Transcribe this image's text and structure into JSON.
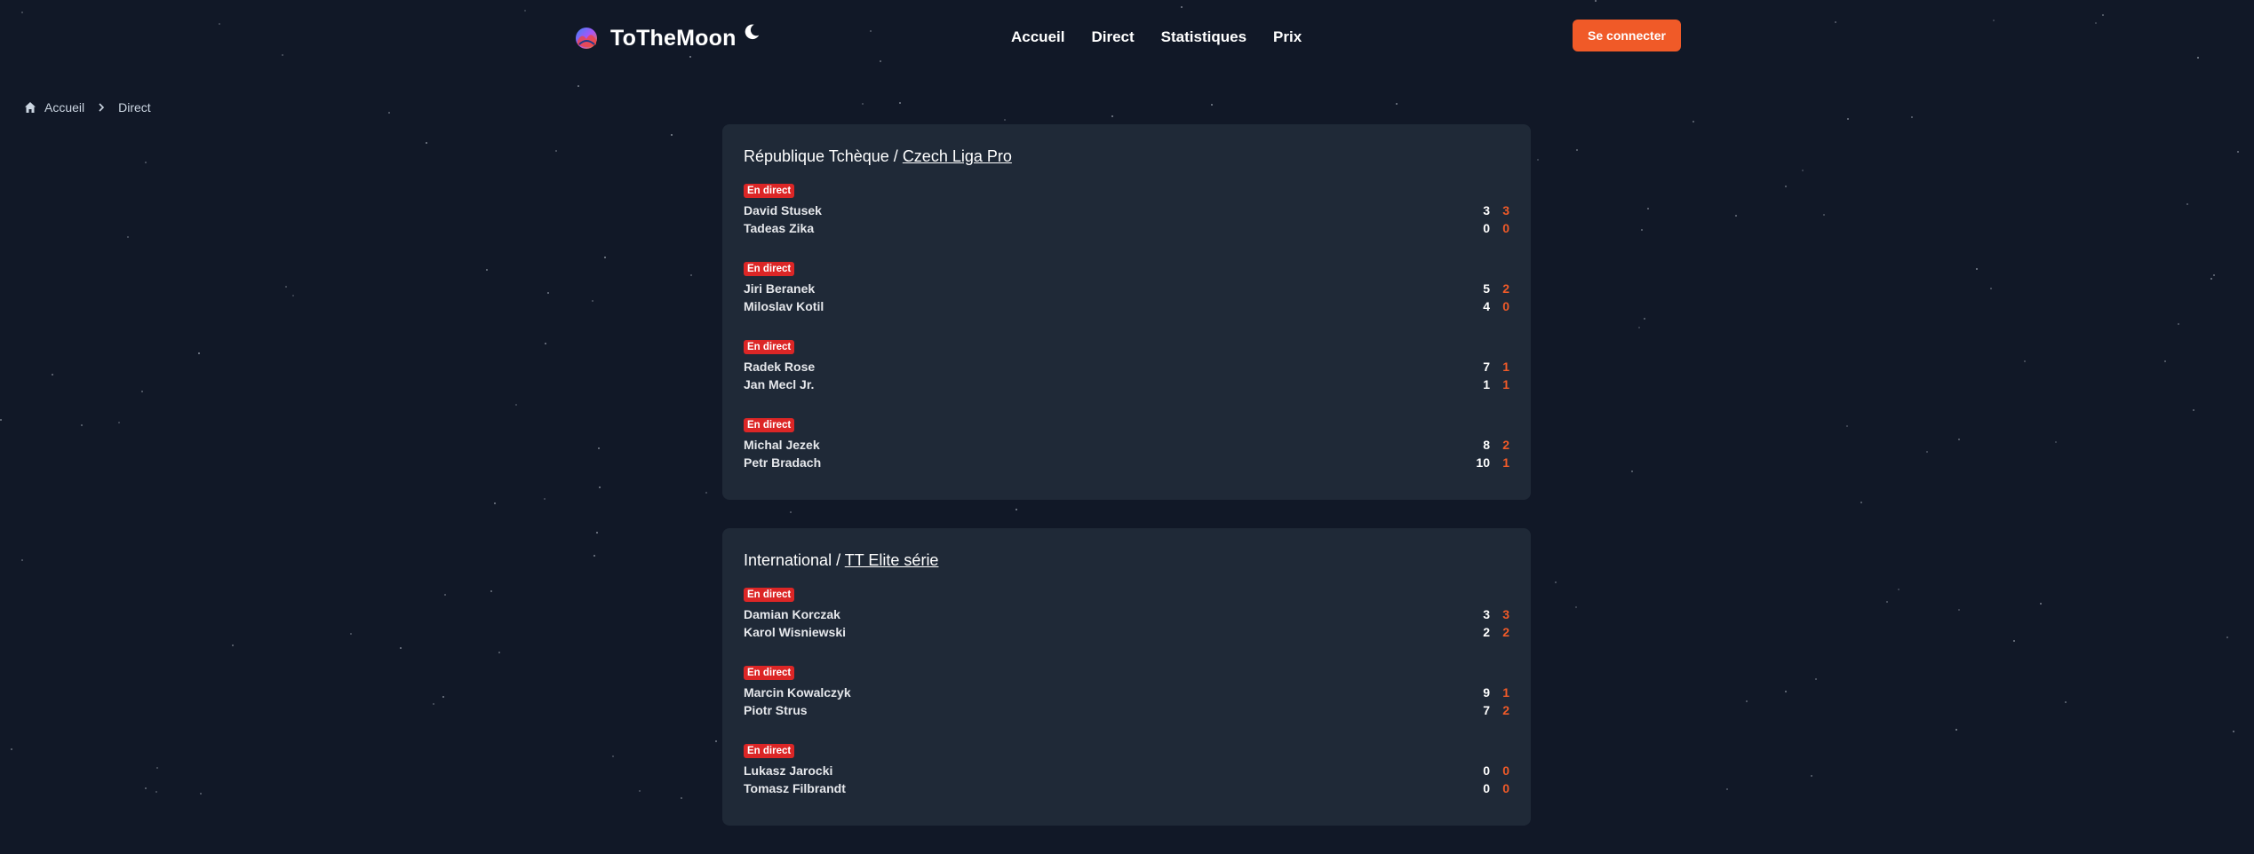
{
  "header": {
    "brand": "ToTheMoon",
    "nav": [
      {
        "label": "Accueil",
        "icon": ""
      },
      {
        "label": "Direct"
      },
      {
        "label": "Statistiques"
      },
      {
        "label": "Prix"
      }
    ],
    "login_label": "Se connecter"
  },
  "breadcrumb": {
    "home": "Accueil",
    "current": "Direct"
  },
  "colors": {
    "background": "#111827",
    "card": "#1f2937",
    "accent": "#f05a28",
    "live": "#dc2626"
  },
  "cards": [
    {
      "region": "République Tchèque / ",
      "league": "Czech Liga Pro",
      "matches": [
        {
          "badge": "En direct",
          "p1": {
            "name": "David Stusek",
            "points": "3",
            "sets": "3"
          },
          "p2": {
            "name": "Tadeas Zika",
            "points": "0",
            "sets": "0"
          }
        },
        {
          "badge": "En direct",
          "p1": {
            "name": "Jiri Beranek",
            "points": "5",
            "sets": "2"
          },
          "p2": {
            "name": "Miloslav Kotil",
            "points": "4",
            "sets": "0"
          }
        },
        {
          "badge": "En direct",
          "p1": {
            "name": "Radek Rose",
            "points": "7",
            "sets": "1"
          },
          "p2": {
            "name": "Jan Mecl Jr.",
            "points": "1",
            "sets": "1"
          }
        },
        {
          "badge": "En direct",
          "p1": {
            "name": "Michal Jezek",
            "points": "8",
            "sets": "2"
          },
          "p2": {
            "name": "Petr Bradach",
            "points": "10",
            "sets": "1"
          }
        }
      ]
    },
    {
      "region": "International / ",
      "league": "TT Elite série",
      "matches": [
        {
          "badge": "En direct",
          "p1": {
            "name": "Damian Korczak",
            "points": "3",
            "sets": "3"
          },
          "p2": {
            "name": "Karol Wisniewski",
            "points": "2",
            "sets": "2"
          }
        },
        {
          "badge": "En direct",
          "p1": {
            "name": "Marcin Kowalczyk",
            "points": "9",
            "sets": "1"
          },
          "p2": {
            "name": "Piotr Strus",
            "points": "7",
            "sets": "2"
          }
        },
        {
          "badge": "En direct",
          "p1": {
            "name": "Lukasz Jarocki",
            "points": "0",
            "sets": "0"
          },
          "p2": {
            "name": "Tomasz Filbrandt",
            "points": "0",
            "sets": "0"
          }
        }
      ]
    }
  ]
}
